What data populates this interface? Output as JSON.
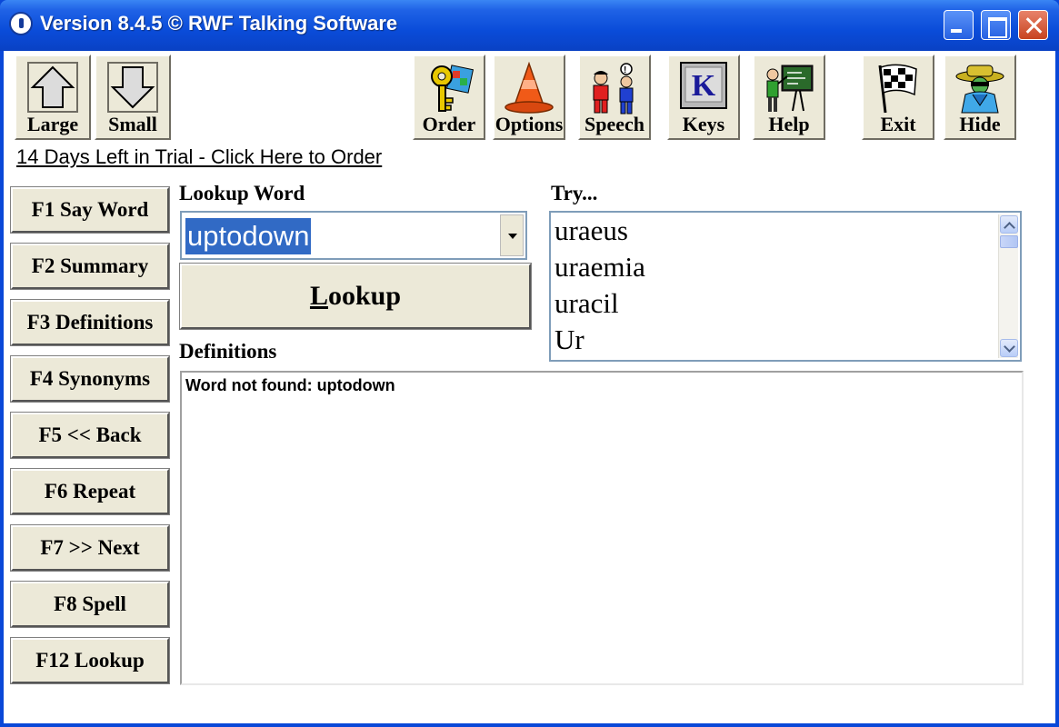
{
  "window": {
    "title": "Version 8.4.5 © RWF Talking Software"
  },
  "toolbar": {
    "large": "Large",
    "small": "Small",
    "order": "Order",
    "options": "Options",
    "speech": "Speech",
    "keys": "Keys",
    "keys_glyph": "K",
    "help": "Help",
    "exit": "Exit",
    "hide": "Hide"
  },
  "trial_link": "14 Days Left in Trial - Click Here to Order",
  "fkeys": [
    "F1 Say Word",
    "F2 Summary",
    "F3 Definitions",
    "F4 Synonyms",
    "F5 << Back",
    "F6 Repeat",
    "F7 >> Next",
    "F8 Spell",
    "F12 Lookup"
  ],
  "lookup": {
    "label": "Lookup Word",
    "value": "uptodown",
    "button_accel": "L",
    "button_rest": "ookup"
  },
  "try": {
    "label": "Try...",
    "items": [
      "uraeus",
      "uraemia",
      "uracil",
      "Ur"
    ]
  },
  "definitions": {
    "label": "Definitions",
    "text": "Word not found: uptodown"
  },
  "colors": {
    "titlebar": "#0a4cd9",
    "face": "#ece9d8",
    "selection": "#316ac5"
  }
}
